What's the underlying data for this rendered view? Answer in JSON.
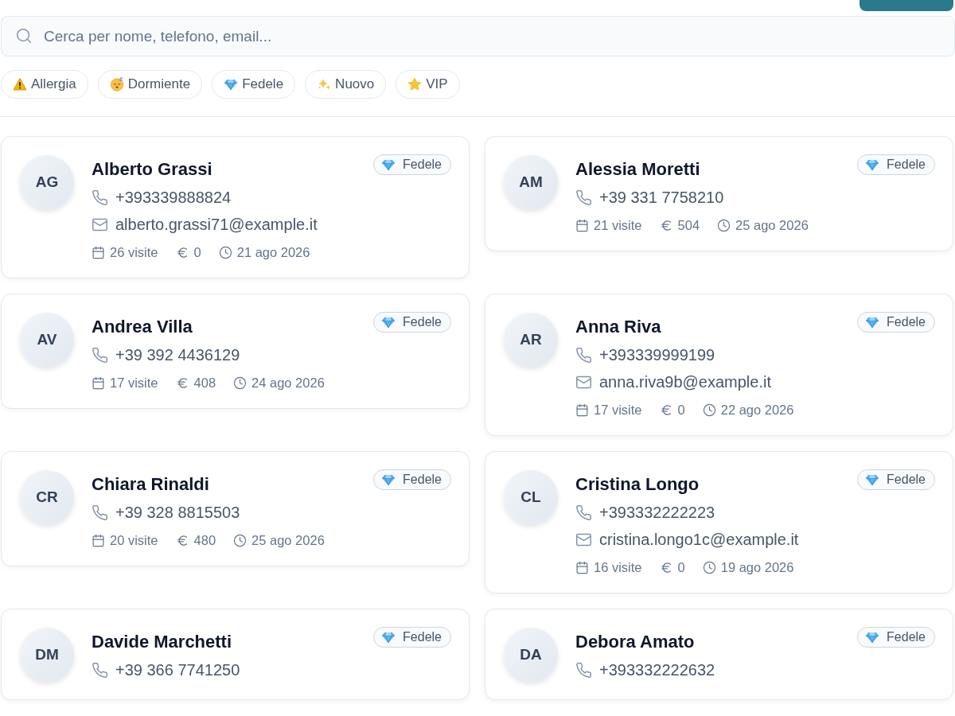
{
  "search": {
    "placeholder": "Cerca per nome, telefono, email..."
  },
  "filters": [
    {
      "label": "Allergia",
      "kind": "warning"
    },
    {
      "label": "Dormiente",
      "kind": "sleepy"
    },
    {
      "label": "Fedele",
      "kind": "gem"
    },
    {
      "label": "Nuovo",
      "kind": "sparkles"
    },
    {
      "label": "VIP",
      "kind": "star"
    }
  ],
  "clients": [
    {
      "initials": "AG",
      "name": "Alberto Grassi",
      "tag": {
        "label": "Fedele",
        "kind": "gem"
      },
      "phone": "+393339888824",
      "email": "alberto.grassi71@example.it",
      "visits": "26 visite",
      "spent": "0",
      "last_visit": "21 ago 2026"
    },
    {
      "initials": "AM",
      "name": "Alessia Moretti",
      "tag": {
        "label": "Fedele",
        "kind": "gem"
      },
      "phone": "+39 331 7758210",
      "visits": "21 visite",
      "spent": "504",
      "last_visit": "25 ago 2026"
    },
    {
      "initials": "AV",
      "name": "Andrea Villa",
      "tag": {
        "label": "Fedele",
        "kind": "gem"
      },
      "phone": "+39 392 4436129",
      "visits": "17 visite",
      "spent": "408",
      "last_visit": "24 ago 2026"
    },
    {
      "initials": "AR",
      "name": "Anna Riva",
      "tag": {
        "label": "Fedele",
        "kind": "gem"
      },
      "phone": "+393339999199",
      "email": "anna.riva9b@example.it",
      "visits": "17 visite",
      "spent": "0",
      "last_visit": "22 ago 2026"
    },
    {
      "initials": "CR",
      "name": "Chiara Rinaldi",
      "tag": {
        "label": "Fedele",
        "kind": "gem"
      },
      "phone": "+39 328 8815503",
      "visits": "20 visite",
      "spent": "480",
      "last_visit": "25 ago 2026"
    },
    {
      "initials": "CL",
      "name": "Cristina Longo",
      "tag": {
        "label": "Fedele",
        "kind": "gem"
      },
      "phone": "+393332222223",
      "email": "cristina.longo1c@example.it",
      "visits": "16 visite",
      "spent": "0",
      "last_visit": "19 ago 2026"
    },
    {
      "initials": "DM",
      "name": "Davide Marchetti",
      "tag": {
        "label": "Fedele",
        "kind": "gem"
      },
      "phone": "+39 366 7741250"
    },
    {
      "initials": "DA",
      "name": "Debora Amato",
      "tag": {
        "label": "Fedele",
        "kind": "gem"
      },
      "phone": "+393332222632"
    }
  ]
}
